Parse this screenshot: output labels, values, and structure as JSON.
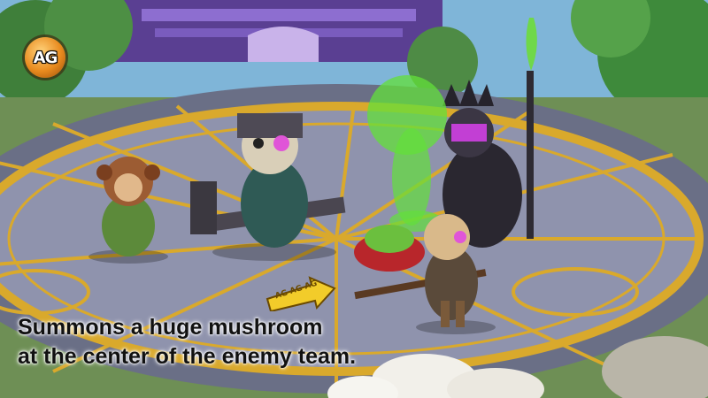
{
  "logo": {
    "text": "AG"
  },
  "caption": {
    "line1": "Summons a huge mushroom",
    "line2": "at the center of the enemy team."
  },
  "pointer": {
    "label": "AG AG AG"
  },
  "colors": {
    "sky": "#7fb5d8",
    "arena_floor": "#8f93ad",
    "arena_gold": "#d9a92c",
    "palace": "#6b4ea8",
    "poison_green": "#63e03a"
  }
}
